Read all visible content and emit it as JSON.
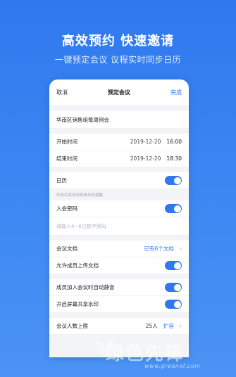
{
  "hero": {
    "title": "高效预约 快速邀请",
    "subtitle": "一键预定会议 议程实时同步日历"
  },
  "topbar": {
    "cancel_label": "取消",
    "title": "预定会议",
    "done_label": "完成"
  },
  "meeting": {
    "name": "华南区销售组每周例会"
  },
  "schedule": {
    "start_label": "开始时间",
    "start_date": "2019-12-20",
    "start_time": "16:00",
    "end_label": "结束时间",
    "end_date": "2019-12-20",
    "end_time": "18:30"
  },
  "calendar": {
    "label": "日历",
    "enabled": true,
    "hint": "开启后将收到系统日历提醒"
  },
  "password": {
    "label": "入会密码",
    "enabled": true,
    "placeholder": "请输入4~6位数字密码"
  },
  "documents": {
    "label": "会议文档",
    "value": "已有6个文档",
    "allow_upload_label": "允许成员上传文档",
    "allow_upload_enabled": true
  },
  "options": {
    "auto_mute_label": "成员加入会议时自动静音",
    "auto_mute_enabled": true,
    "watermark_label": "开启屏幕共享水印",
    "watermark_enabled": true
  },
  "capacity": {
    "label": "会议人数上限",
    "value": "25人",
    "expand_label": "扩容"
  },
  "site_watermark": {
    "text": "绿色先锋",
    "url": "www.greenxf.com"
  },
  "colors": {
    "accent": "#2f78ee",
    "background_top": "#2f78ee",
    "background_bottom": "#4b93f4"
  }
}
